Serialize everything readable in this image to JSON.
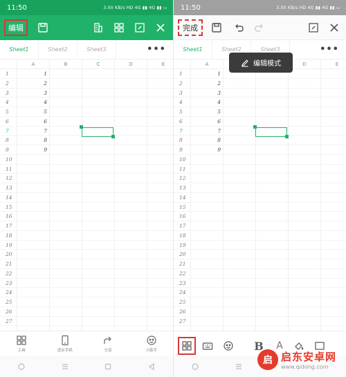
{
  "status": {
    "time": "11:50",
    "indicators": "3.00 KB/s  HD  4G  ▮▮  4G  ▮▮  ▭"
  },
  "left": {
    "edit_label": "编辑",
    "sheets": [
      "Sheet1",
      "Sheet2",
      "Sheet3"
    ],
    "more_label": "•••",
    "columns": [
      "A",
      "B",
      "C",
      "D",
      "E"
    ],
    "row_numbers": [
      "1",
      "2",
      "3",
      "4",
      "5",
      "6",
      "7",
      "8",
      "9",
      "10",
      "11",
      "12",
      "13",
      "14",
      "15",
      "16",
      "17",
      "18",
      "19",
      "20",
      "21",
      "22",
      "23",
      "24",
      "25",
      "26",
      "27"
    ],
    "column_a_values": [
      "1",
      "2",
      "3",
      "4",
      "5",
      "6",
      "7",
      "8",
      "9"
    ],
    "bottom_tools": [
      "工具",
      "适合手机",
      "分享",
      "小助手"
    ]
  },
  "right": {
    "done_label": "完成",
    "sheets": [
      "Sheet1",
      "Sheet2",
      "Sheet3"
    ],
    "more_label": "•••",
    "columns": [
      "A",
      "B",
      "C",
      "D",
      "E"
    ],
    "row_numbers": [
      "1",
      "2",
      "3",
      "4",
      "5",
      "6",
      "7",
      "8",
      "9",
      "10",
      "11",
      "12",
      "13",
      "14",
      "15",
      "16",
      "17",
      "18",
      "19",
      "20",
      "21",
      "22",
      "23",
      "24",
      "25",
      "26",
      "27"
    ],
    "column_a_values": [
      "1",
      "2",
      "3",
      "4",
      "5",
      "6",
      "7",
      "8",
      "9"
    ],
    "tooltip_label": "编辑模式",
    "format_bold": "B",
    "format_letter": "A"
  },
  "watermark": {
    "title": "启东安卓网",
    "url": "www.qidong.com"
  },
  "colors": {
    "primary_green": "#21b26a",
    "status_green": "#18a35c",
    "highlight_red": "#d93636"
  }
}
